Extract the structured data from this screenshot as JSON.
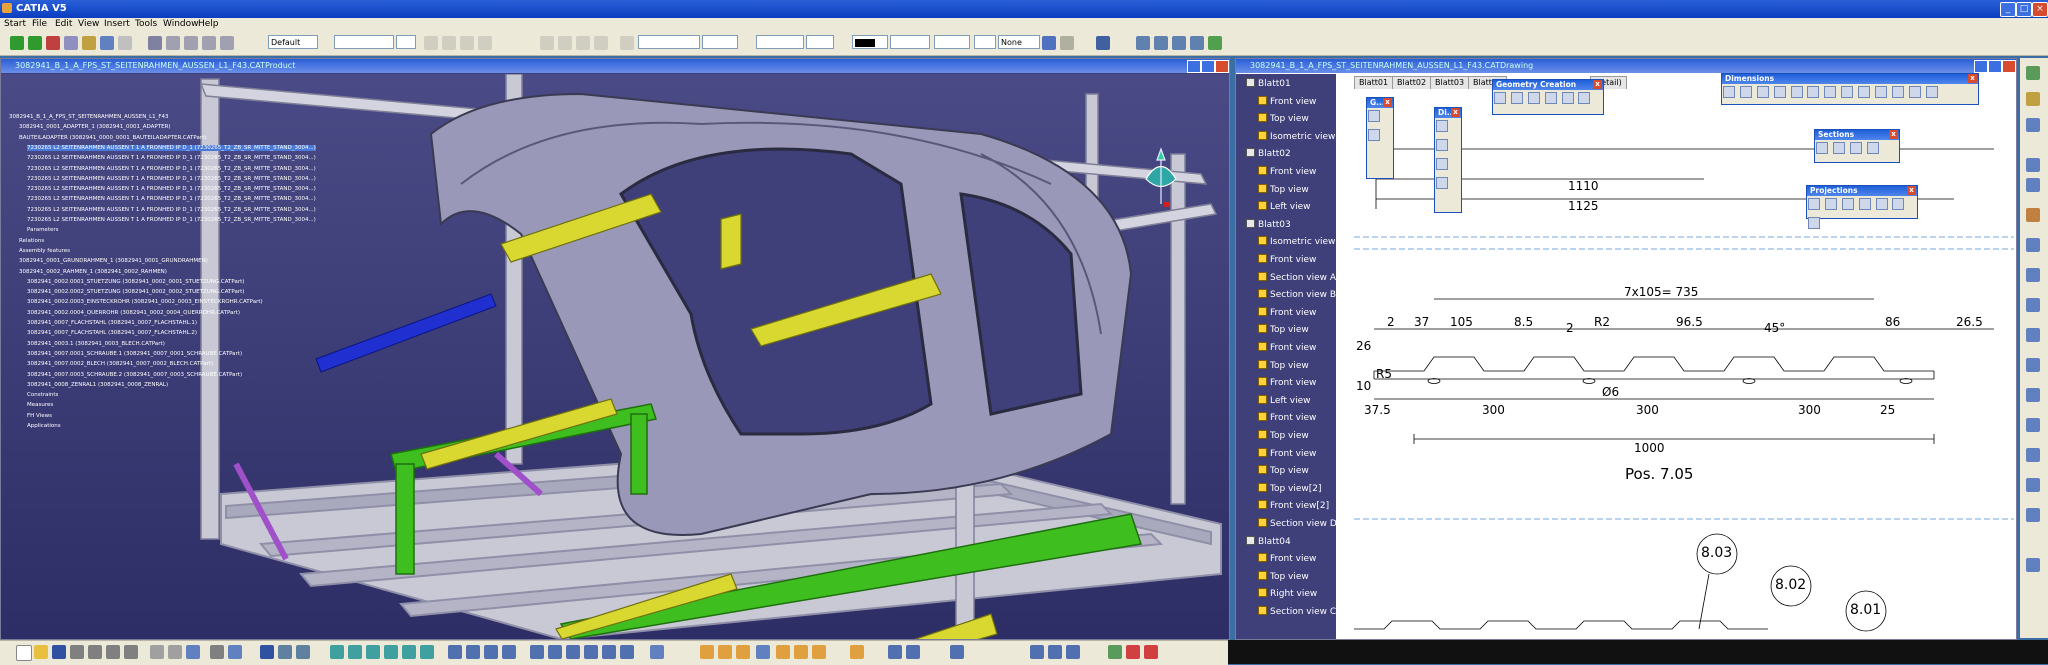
{
  "app": {
    "title": "CATIA V5"
  },
  "menu": [
    "Start",
    "File",
    "Edit",
    "View",
    "Insert",
    "Tools",
    "Window",
    "Help"
  ],
  "toolbar": {
    "style_combo": "Default",
    "line_type_combo": "None"
  },
  "left_window": {
    "title": "3082941_B_1_A_FPS_ST_SEITENRAHMEN_AUSSEN_L1_F43.CATProduct",
    "tree": [
      "3082941_B_1_A_FPS_ST_SEITENRAHMEN_AUSSEN_L1_F43",
      "3082941_0001_ADAPTER_1 (3082941_0001_ADAPTER)",
      "BAUTEILADAPTER (3082941_0000_0001_BAUTEILADAPTER.CATPart)",
      "7230265 L2 SEITENRAHMEN AUSSEN    T  1  A  FRONHED IP  D_1 (7230265_T2_ZB_SR_MITTE_STAND_3004...)",
      "7230265 L2 SEITENRAHMEN AUSSEN    T  1  A  FRONHED IP  D_1 (7230265_T2_ZB_SR_MITTE_STAND_3004...)",
      "7230265 L2 SEITENRAHMEN AUSSEN    T  1  A  FRONHED IP  D_1 (7230265_T2_ZB_SR_MITTE_STAND_3004...)",
      "7230265 L2 SEITENRAHMEN AUSSEN    T  1  A  FRONHED IP  D_1 (7230265_T2_ZB_SR_MITTE_STAND_3004...)",
      "7230265 L2 SEITENRAHMEN AUSSEN    T  1  A  FRONHED IP  D_1 (7230265_T2_ZB_SR_MITTE_STAND_3004...)",
      "7230265 L2 SEITENRAHMEN AUSSEN    T  1  A  FRONHED IP  D_1 (7230265_T2_ZB_SR_MITTE_STAND_3004...)",
      "7230265 L2 SEITENRAHMEN AUSSEN    T  1  A  FRONHED IP  D_1 (7230265_T2_ZB_SR_MITTE_STAND_3004...)",
      "7230265 L2 SEITENRAHMEN AUSSEN    T  1  A  FRONHED IP  D_1 (7230265_T2_ZB_SR_MITTE_STAND_3004...)",
      "Parameters",
      "Relations",
      "Assembly features",
      "3082941_0001_GRUNDRAHMEN_1 (3082941_0001_GRUNDRAHMEN)",
      "3082941_0002_RAHMEN_1 (3082941_0002_RAHMEN)",
      "3082941_0002.0001_STUETZUNG (3082941_0002_0001_STUETZUNG.CATPart)",
      "3082941_0002.0002_STUETZUNG (3082941_0002_0002_STUETZUNG.CATPart)",
      "3082941_0002.0003_EINSTECKROHR (3082941_0002_0003_EINSTECKROHR.CATPart)",
      "3082941_0002.0004_QUERROHR (3082941_0002_0004_QUERROHR.CATPart)",
      "3082941_0007_FLACHSTAHL (3082941_0007_FLACHSTAHL.1)",
      "3082941_0007_FLACHSTAHL (3082941_0007_FLACHSTAHL.2)",
      "3082941_0003.1 (3082941_0003_BLECH.CATPart)",
      "3082941_0007.0001_SCHRAUBE.1 (3082941_0007_0001_SCHRAUBE.CATPart)",
      "3082941_0007.0002_BLECH (3082941_0007_0002_BLECH.CATPart)",
      "3082941_0007.0003_SCHRAUBE.2 (3082941_0007_0003_SCHRAUBE.CATPart)",
      "3082941_0008_ZENRAL1 (3082941_0008_ZENRAL)",
      "Constraints",
      "Measures",
      "FH Views",
      "Applications"
    ]
  },
  "right_window": {
    "title": "3082941_B_1_A_FPS_ST_SEITENRAHMEN_AUSSEN_L1_F43.CATDrawing",
    "tree": [
      {
        "label": "Blatt01",
        "level": 0
      },
      {
        "label": "Front view",
        "level": 1
      },
      {
        "label": "Top view",
        "level": 1
      },
      {
        "label": "Isometric view",
        "level": 1
      },
      {
        "label": "Blatt02",
        "level": 0
      },
      {
        "label": "Front view",
        "level": 1
      },
      {
        "label": "Top view",
        "level": 1
      },
      {
        "label": "Left view",
        "level": 1
      },
      {
        "label": "Blatt03",
        "level": 0
      },
      {
        "label": "Isometric view",
        "level": 1
      },
      {
        "label": "Front view",
        "level": 1
      },
      {
        "label": "Section view A-",
        "level": 1
      },
      {
        "label": "Section view B-",
        "level": 1
      },
      {
        "label": "Front view",
        "level": 1
      },
      {
        "label": "Top view",
        "level": 1
      },
      {
        "label": "Front view",
        "level": 1
      },
      {
        "label": "Top view",
        "level": 1
      },
      {
        "label": "Front view",
        "level": 1
      },
      {
        "label": "Left view",
        "level": 1
      },
      {
        "label": "Front view",
        "level": 1
      },
      {
        "label": "Top view",
        "level": 1
      },
      {
        "label": "Front view",
        "level": 1
      },
      {
        "label": "Top view",
        "level": 1
      },
      {
        "label": "Top view[2]",
        "level": 1
      },
      {
        "label": "Front view[2]",
        "level": 1
      },
      {
        "label": "Section view D-",
        "level": 1
      },
      {
        "label": "Blatt04",
        "level": 0
      },
      {
        "label": "Front view",
        "level": 1
      },
      {
        "label": "Top view",
        "level": 1
      },
      {
        "label": "Right view",
        "level": 1
      },
      {
        "label": "Section view C-",
        "level": 1
      }
    ],
    "sheet_tabs": [
      "Blatt01",
      "Blatt02",
      "Blatt03",
      "Blatt04",
      "Detail)"
    ],
    "palettes": {
      "geometry_creation": "Geometry Creation",
      "dimensions": "Dimensions",
      "sections": "Sections",
      "projections": "Projections",
      "small_a": "G...",
      "small_b": "Di..."
    },
    "drawing": {
      "dim_1110": "1110",
      "dim_1125": "1125",
      "dim_7x105": "7x105= 735",
      "dim_2a": "2",
      "dim_37": "37",
      "dim_105": "105",
      "dim_85": "8.5",
      "dim_2b": "2",
      "dim_r2": "R2",
      "dim_965": "96.5",
      "dim_45": "45°",
      "dim_86": "86",
      "dim_265": "26.5",
      "dim_26": "26",
      "dim_10": "10",
      "dim_r5": "R5",
      "dim_d6": "Ø6",
      "dim_375": "37.5",
      "dim_300a": "300",
      "dim_300b": "300",
      "dim_300c": "300",
      "dim_25": "25",
      "dim_1000": "1000",
      "part_label": "Pos. 7.05",
      "balloon_1": "8.03",
      "balloon_2": "8.02",
      "balloon_3": "8.01"
    }
  },
  "colors": {
    "viewport_bg": "#3f3f7a",
    "titlebar": "#0a3ec0",
    "frame_steel": "#c9c9d6",
    "locator_yellow": "#d8d830",
    "bracket_green": "#3fbf1f",
    "bar_blue": "#1f2fd0",
    "strut_purple": "#a050c8"
  }
}
